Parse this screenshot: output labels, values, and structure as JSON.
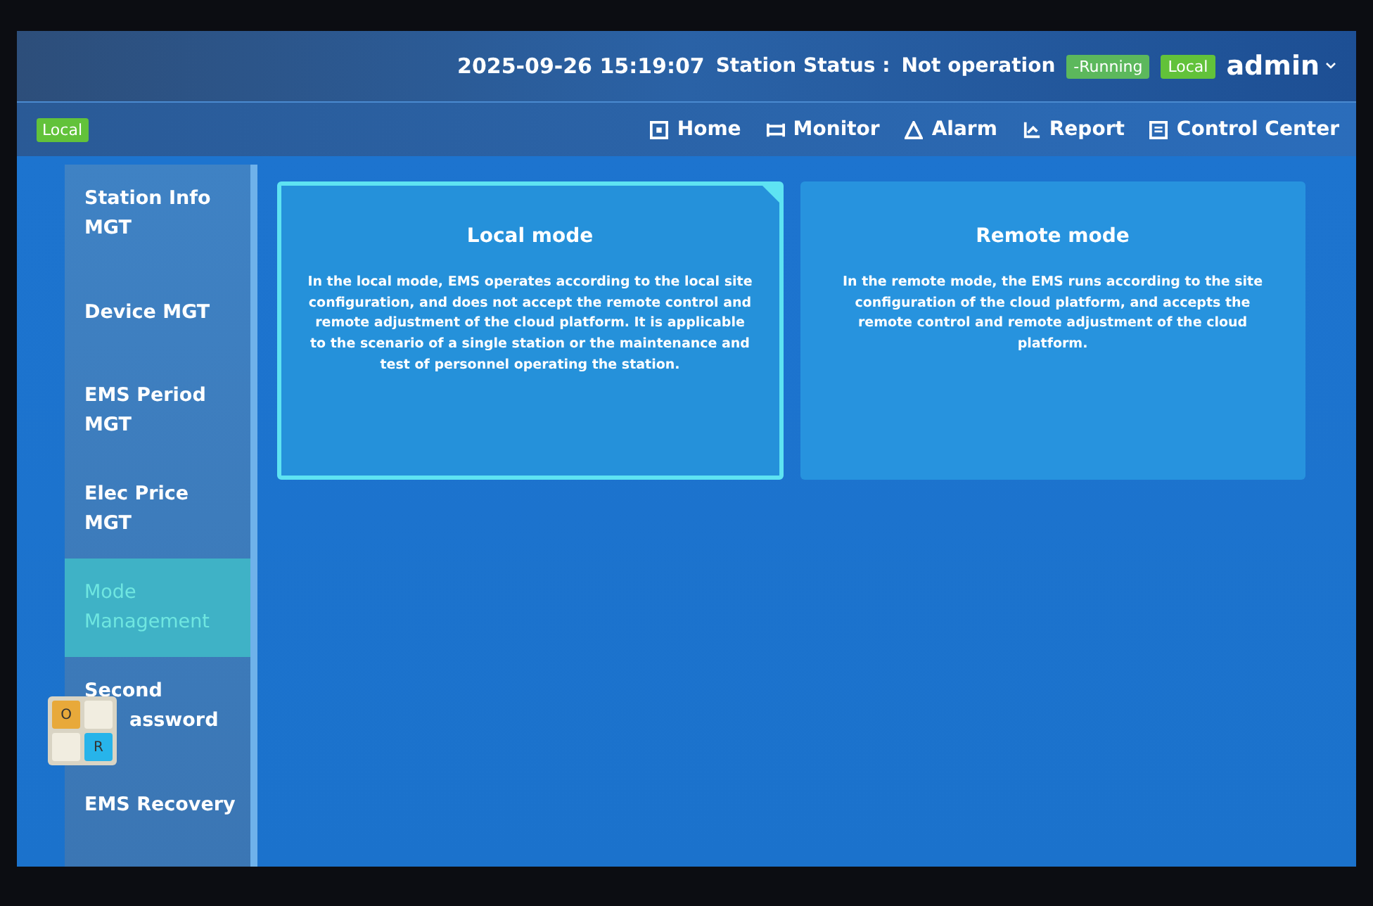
{
  "header": {
    "datetime": "2025-09-26 15:19:07",
    "status_label": "Station Status :",
    "status_value": "Not operation",
    "running_badge": "-Running",
    "mode_badge": "Local",
    "user": "admin"
  },
  "mode_tag": "Local",
  "nav": [
    {
      "label": "Home"
    },
    {
      "label": "Monitor"
    },
    {
      "label": "Alarm"
    },
    {
      "label": "Report"
    },
    {
      "label": "Control Center"
    }
  ],
  "sidebar": {
    "items": [
      {
        "label": "Station Info MGT",
        "selected": false
      },
      {
        "label": "Device MGT",
        "selected": false
      },
      {
        "label": "EMS Period MGT",
        "selected": false
      },
      {
        "label": "Elec Price MGT",
        "selected": false
      },
      {
        "label": "Mode Management",
        "selected": true
      },
      {
        "label": "Second",
        "label_cont": "assword",
        "selected": false
      },
      {
        "label": "EMS Recovery",
        "selected": false
      }
    ]
  },
  "modes": [
    {
      "title": "Local mode",
      "description": "In the local mode, EMS operates according to the local site configuration, and does not accept the remote control and remote adjustment of the cloud platform. It is applicable to the scenario of a single station or the maintenance and test of personnel operating the station.",
      "selected": true
    },
    {
      "title": "Remote mode",
      "description": "In the remote mode, the EMS runs according to the site configuration of the cloud platform, and accepts the remote control and remote adjustment of the cloud platform.",
      "selected": false
    }
  ],
  "floating_widget": {
    "keys": [
      {
        "label": "O",
        "color": "#e8a93a"
      },
      {
        "color": "#f1ede0"
      },
      {
        "color": "#f1ede0"
      },
      {
        "label": "R",
        "color": "#27b4ea"
      }
    ]
  }
}
